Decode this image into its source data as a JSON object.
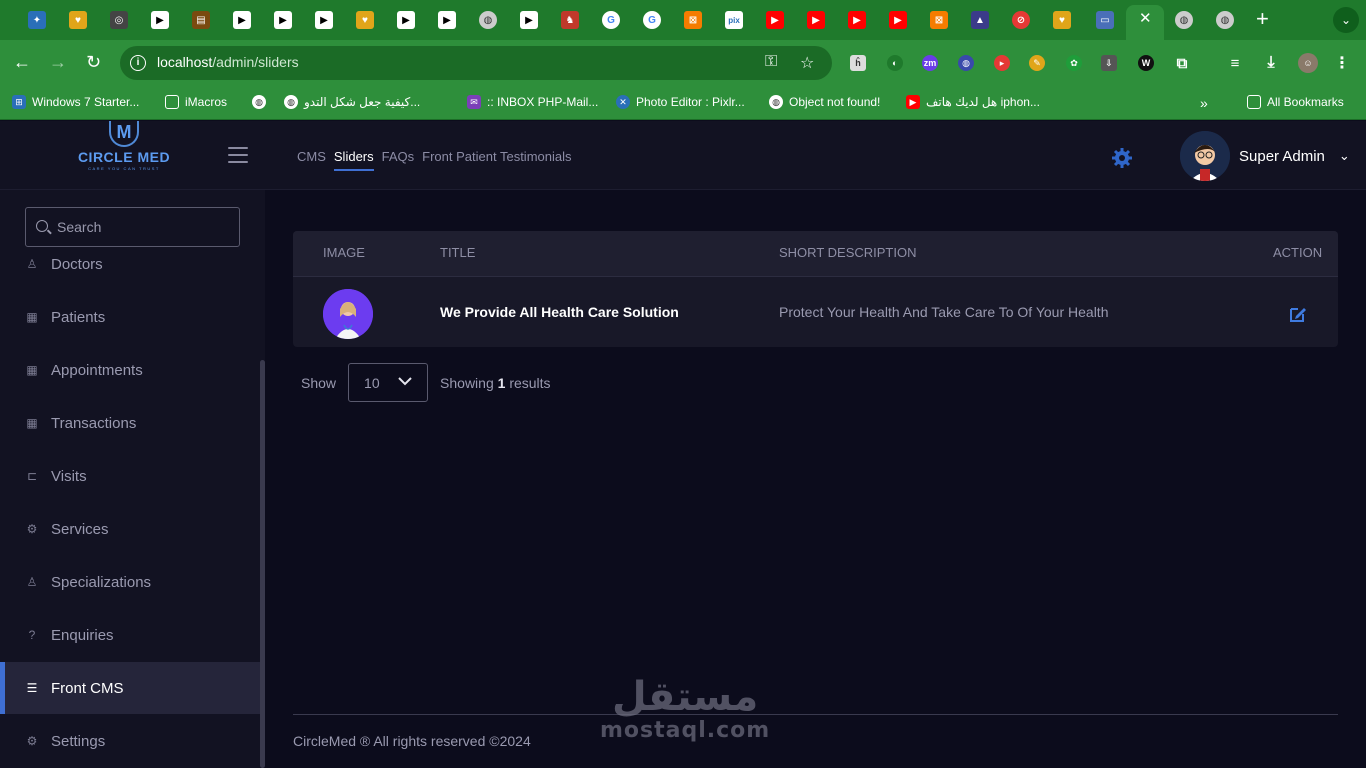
{
  "browser": {
    "url_host": "localhost",
    "url_path": "/admin/sliders",
    "tab_close": "✕",
    "new_tab": "+",
    "bookmarks": [
      {
        "label": "Windows 7 Starter..."
      },
      {
        "label": "iMacros"
      },
      {
        "label": ""
      },
      {
        "label": "كيفية جعل شكل التدو..."
      },
      {
        "label": ":: INBOX PHP-Mail..."
      },
      {
        "label": "Photo Editor : Pixlr..."
      },
      {
        "label": "Object not found!"
      },
      {
        "label": "هل لديك هاتف iphon..."
      }
    ],
    "more_bookmarks": "»",
    "all_bookmarks": "All Bookmarks"
  },
  "app": {
    "logo": {
      "mark": "M",
      "name": "CIRCLE MED",
      "tagline": "CARE YOU CAN TRUST"
    },
    "topnav": [
      {
        "label": "CMS",
        "active": false
      },
      {
        "label": "Sliders",
        "active": true
      },
      {
        "label": "FAQs",
        "active": false
      },
      {
        "label": "Front Patient Testimonials",
        "active": false
      }
    ],
    "user_name": "Super Admin",
    "search_placeholder": "Search",
    "sidebar": [
      {
        "label": "Doctors",
        "icon": "doctor-icon"
      },
      {
        "label": "Patients",
        "icon": "patients-icon"
      },
      {
        "label": "Appointments",
        "icon": "calendar-icon"
      },
      {
        "label": "Transactions",
        "icon": "calendar-icon"
      },
      {
        "label": "Visits",
        "icon": "bed-icon"
      },
      {
        "label": "Services",
        "icon": "user-gear-icon"
      },
      {
        "label": "Specializations",
        "icon": "user-shield-icon"
      },
      {
        "label": "Enquiries",
        "icon": "question-icon"
      },
      {
        "label": "Front CMS",
        "icon": "list-check-icon",
        "active": true
      },
      {
        "label": "Settings",
        "icon": "gears-icon"
      }
    ],
    "table": {
      "headers": [
        "IMAGE",
        "TITLE",
        "SHORT DESCRIPTION",
        "ACTION"
      ],
      "rows": [
        {
          "title": "We Provide All Health Care Solution",
          "description": "Protect Your Health And Take Care To Of Your Health"
        }
      ]
    },
    "pager": {
      "show_label": "Show",
      "per_page": "10",
      "showing_prefix": "Showing",
      "count": "1",
      "showing_suffix": "results"
    },
    "footer": "CircleMed ® All rights reserved ©2024",
    "watermark": {
      "arabic": "مستقل",
      "latin": "mostaql.com"
    },
    "colors": {
      "accent": "#3f6fd2",
      "background": "#0c0c1c",
      "panel": "#121222",
      "browser_green": "#2e8f3b"
    }
  }
}
